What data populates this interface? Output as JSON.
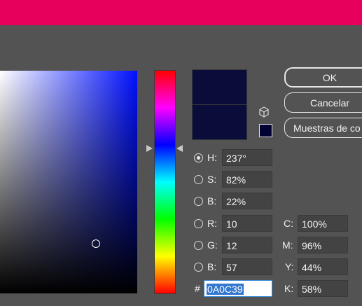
{
  "buttons": {
    "ok": "OK",
    "cancel": "Cancelar",
    "swatches": "Muestras de co"
  },
  "colors": {
    "title_bar": "#e8005d",
    "new_color": "#0a0c39",
    "current_color": "#0a0c39",
    "websafe_color": "#000033"
  },
  "icons": {
    "out_of_gamut": "cube-icon"
  },
  "hue_slider_level": 0.66,
  "fields": {
    "h": {
      "label": "H:",
      "value": "237°"
    },
    "s": {
      "label": "S:",
      "value": "82%"
    },
    "b": {
      "label": "B:",
      "value": "22%"
    },
    "r": {
      "label": "R:",
      "value": "10"
    },
    "g": {
      "label": "G:",
      "value": "12"
    },
    "b_rgb": {
      "label": "B:",
      "value": "57"
    },
    "c": {
      "label": "C:",
      "value": "100%"
    },
    "m": {
      "label": "M:",
      "value": "96%"
    },
    "y": {
      "label": "Y:",
      "value": "44%"
    },
    "k": {
      "label": "K:",
      "value": "58%"
    },
    "hex": {
      "label": "#",
      "value": "0A0C39"
    }
  }
}
